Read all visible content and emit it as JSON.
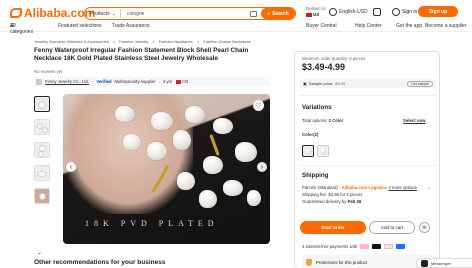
{
  "header": {
    "logo_text": "Alibaba.com",
    "search_category": "Products",
    "search_query": "coiogne",
    "search_button": "Search",
    "deliver_label": "Deliver to:",
    "deliver_country": "US",
    "language": "English-USD",
    "cart_label": "Cart",
    "signin": "Sign in",
    "signup": "Sign up"
  },
  "subnav": {
    "all_categories": "All categories",
    "featured": "Featured selections",
    "trade_assurance": "Trade Assurance",
    "buyer_central": "Buyer Central",
    "help_center": "Help Center",
    "get_app": "Get the app",
    "become_supplier": "Become a supplier"
  },
  "breadcrumb": [
    "Jewelry, Eyewear, Watches & Accessories",
    ">",
    "Fashion Jewelry",
    ">",
    "Fashion Necklaces",
    ">",
    "Fashion Chains Necklaces"
  ],
  "product": {
    "title": "Fenny Waterproof Irregular Fashion Statement Block Shell Pearl Chain Necklace 18K Gold Plated Stainless Steel Jewelry Wholesale",
    "reviews": "No reviews yet",
    "supplier_name": "Fenny Jewelry Co., Ltd.",
    "verified": "Verified",
    "supplier_type": "Multispecialty supplier",
    "years": "4 yrs",
    "country": "CN",
    "image_watermark": "18K PVD PLATED"
  },
  "other_section_title": "Other recommendations for your business",
  "panel": {
    "min_order": "Minimum order quantity: 2 pieces",
    "price": "$3.49-4.99",
    "sample_label": "Sample price:",
    "sample_price": "$4.99",
    "get_sample": "Get sample",
    "variations_title": "Variations",
    "total_options": "Total options:",
    "total_options_value": "2 Color",
    "select_now": "Select now",
    "color_label": "Color(2)",
    "shipping_title": "Shipping",
    "parcels": "Parcels (Standard)",
    "alibaba_logistics": "Alibaba.com Logistics",
    "more_options": "2 more options",
    "shipping_fee": "Shipping fee: $3.96 for 2 pieces",
    "delivery_prefix": "Guaranteed delivery by",
    "delivery_date": "Feb 26",
    "start_order": "Start order",
    "add_to_cart": "Add to cart",
    "interest_free": "4 interest-free payments with",
    "protections": "Protections for this product"
  },
  "messenger": "Messenger"
}
